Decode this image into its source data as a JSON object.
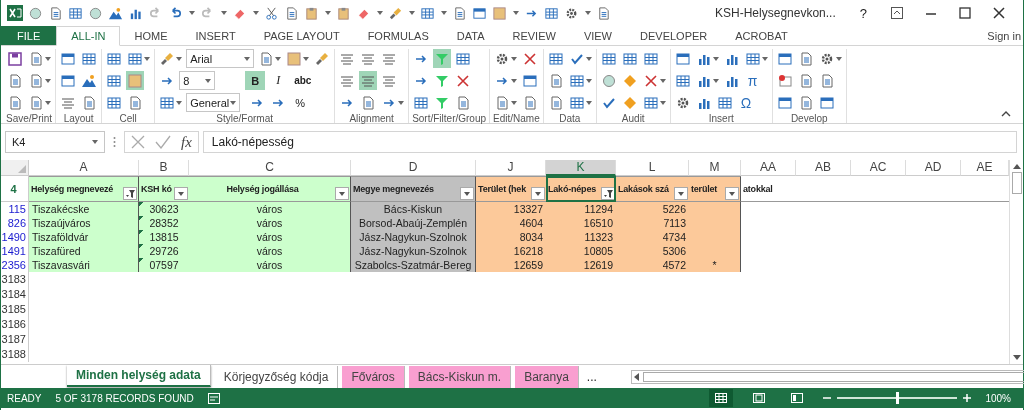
{
  "window": {
    "title": "KSH-Helysegnevkon...",
    "help": "?"
  },
  "ribbon_tabs": [
    {
      "label": "FILE",
      "kind": "file",
      "selected": false
    },
    {
      "label": "ALL-IN",
      "kind": "tab",
      "selected": true
    },
    {
      "label": "HOME",
      "kind": "tab",
      "selected": false
    },
    {
      "label": "INSERT",
      "kind": "tab",
      "selected": false
    },
    {
      "label": "PAGE LAYOUT",
      "kind": "tab",
      "selected": false
    },
    {
      "label": "FORMULAS",
      "kind": "tab",
      "selected": false
    },
    {
      "label": "DATA",
      "kind": "tab",
      "selected": false
    },
    {
      "label": "REVIEW",
      "kind": "tab",
      "selected": false
    },
    {
      "label": "VIEW",
      "kind": "tab",
      "selected": false
    },
    {
      "label": "DEVELOPER",
      "kind": "tab",
      "selected": false
    },
    {
      "label": "ACROBAT",
      "kind": "tab",
      "selected": false
    }
  ],
  "sign_in": "Sign in",
  "ribbon": {
    "font_name": "Arial",
    "font_size": "8",
    "number_format": "General",
    "format_buttons": [
      {
        "label": "B",
        "selected": true
      },
      {
        "label": "I",
        "selected": false
      },
      {
        "label": "abc",
        "selected": false
      },
      {
        "label": "%",
        "selected": false
      }
    ],
    "symbols": [
      "π",
      "Ω"
    ],
    "groups": [
      "Save/Print",
      "Layout",
      "Cell",
      "Style/Format",
      "Alignment",
      "Sort/Filter/Group",
      "Edit/Name",
      "Data",
      "Audit",
      "Insert",
      "Develop"
    ]
  },
  "formula_bar": {
    "name_box": "K4",
    "function_label": "fx",
    "formula": "Lakó-népesség"
  },
  "sheet": {
    "columns": [
      {
        "letter": "A",
        "selected": false
      },
      {
        "letter": "B",
        "selected": false
      },
      {
        "letter": "C",
        "selected": false
      },
      {
        "letter": "D",
        "selected": false
      },
      {
        "letter": "J",
        "selected": false
      },
      {
        "letter": "K",
        "selected": true
      },
      {
        "letter": "L",
        "selected": false
      },
      {
        "letter": "M",
        "selected": false
      },
      {
        "letter": "AA",
        "selected": false
      },
      {
        "letter": "AB",
        "selected": false
      },
      {
        "letter": "AC",
        "selected": false
      },
      {
        "letter": "AD",
        "selected": false
      },
      {
        "letter": "AE",
        "selected": false
      }
    ],
    "header_row_number": "4",
    "headers": [
      {
        "text": "Helység megnevezé",
        "filtered": true,
        "color": "#ccffcc"
      },
      {
        "text": "KSH kó",
        "filtered": false,
        "color": "#ccffcc"
      },
      {
        "text": "Helység jogállása",
        "filtered": false,
        "color": "#ccffcc"
      },
      {
        "text": "Megye megnevezés",
        "filtered": false,
        "color": "#c0c0c0"
      },
      {
        "text": "Terület  (hek",
        "filtered": false,
        "color": "#fcc99a"
      },
      {
        "text": "Lakó-népes",
        "filtered": true,
        "color": "#fcc99a"
      },
      {
        "text": "Lakások szá",
        "filtered": false,
        "color": "#fcc99a"
      },
      {
        "text": "terület",
        "filtered": false,
        "color": "#fcc99a"
      }
    ],
    "header_overflow": "atokkal",
    "rows": [
      {
        "row_number": "115",
        "cells": [
          "Tiszakécske",
          "30623",
          "város",
          "Bács-Kiskun",
          "13327",
          "11294",
          "5226",
          ""
        ]
      },
      {
        "row_number": "826",
        "cells": [
          "Tiszaújváros",
          "28352",
          "város",
          "Borsod-Abaúj-Zemplén",
          "4604",
          "16510",
          "7113",
          ""
        ]
      },
      {
        "row_number": "1490",
        "cells": [
          "Tiszaföldvár",
          "13815",
          "város",
          "Jász-Nagykun-Szolnok",
          "8034",
          "11323",
          "4734",
          ""
        ]
      },
      {
        "row_number": "1491",
        "cells": [
          "Tiszafüred",
          "29726",
          "város",
          "Jász-Nagykun-Szolnok",
          "16218",
          "10805",
          "5306",
          ""
        ]
      },
      {
        "row_number": "2356",
        "cells": [
          "Tiszavasvári",
          "07597",
          "város",
          "Szabolcs-Szatmár-Bereg",
          "12659",
          "12619",
          "4572",
          "*"
        ]
      }
    ],
    "empty_rows": [
      "3183",
      "3184",
      "3185",
      "3186",
      "3187",
      "3188"
    ]
  },
  "sheet_tabs": [
    {
      "label": "Minden helység adata",
      "selected": true,
      "color": "#ffffff"
    },
    {
      "label": "Körjegyzőség kódja",
      "selected": false,
      "color": "#ffffff"
    },
    {
      "label": "Főváros",
      "selected": false,
      "color": "#f99fd0"
    },
    {
      "label": "Bács-Kiskun m.",
      "selected": false,
      "color": "#f99fd0"
    },
    {
      "label": "Baranya",
      "selected": false,
      "color": "#f99fd0"
    }
  ],
  "more_tabs": "...",
  "status_bar": {
    "mode": "READY",
    "records": "5 OF 3178 RECORDS FOUND",
    "zoom": "100%",
    "zoom_level": {
      "level": 0.5
    }
  }
}
